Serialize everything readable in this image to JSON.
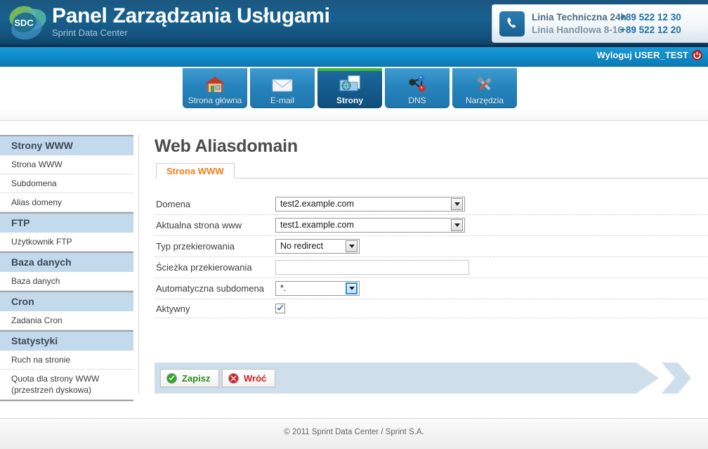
{
  "header": {
    "logo_text": "SDC",
    "title": "Panel Zarządzania Usługami",
    "subtitle": "Sprint Data Center",
    "phone": {
      "icon": "phone-icon",
      "line1_label": "Linia Techniczna 24h",
      "line1_number": "+89 522 12 30",
      "line2_label": "Linia Handlowa 8-16",
      "line2_number": "+89 522 12 20"
    }
  },
  "topbar": {
    "logout_label": "Wyloguj USER_TEST",
    "logout_icon": "power-icon"
  },
  "nav": {
    "tabs": [
      {
        "label": "Strona główna",
        "icon": "house-icon",
        "active": false
      },
      {
        "label": "E-mail",
        "icon": "envelope-icon",
        "active": false
      },
      {
        "label": "Strony",
        "icon": "web-folder-icon",
        "active": true
      },
      {
        "label": "DNS",
        "icon": "molecule-icon",
        "active": false
      },
      {
        "label": "Narzędzia",
        "icon": "tools-icon",
        "active": false
      }
    ]
  },
  "sidebar": {
    "groups": [
      {
        "title": "Strony WWW",
        "items": [
          "Strona WWW",
          "Subdomena",
          "Alias domeny"
        ]
      },
      {
        "title": "FTP",
        "items": [
          "Użytkownik FTP"
        ]
      },
      {
        "title": "Baza danych",
        "items": [
          "Baza danych"
        ]
      },
      {
        "title": "Cron",
        "items": [
          "Zadania Cron"
        ]
      },
      {
        "title": "Statystyki",
        "items": [
          "Ruch na stronie",
          "Quota dla strony WWW (przestrzeń dyskowa)"
        ]
      }
    ]
  },
  "main": {
    "page_title": "Web Aliasdomain",
    "strip_tab": "Strona WWW",
    "fields": {
      "domena": {
        "label": "Domena",
        "value": "test2.example.com"
      },
      "aktualna": {
        "label": "Aktualna strona www",
        "value": "test1.example.com"
      },
      "typ": {
        "label": "Typ przekierowania",
        "value": "No redirect"
      },
      "sciezka": {
        "label": "Ścieżka przekierowania",
        "value": "",
        "placeholder": ""
      },
      "subdomena": {
        "label": "Automatyczna subdomena",
        "value": "*."
      },
      "aktywny": {
        "label": "Aktywny",
        "checked": true
      }
    }
  },
  "actions": {
    "save_label": "Zapisz",
    "save_icon": "check-circle-icon",
    "back_label": "Wróć",
    "back_icon": "x-circle-icon"
  },
  "footer": {
    "text": "© 2011 Sprint Data Center / Sprint S.A."
  },
  "colors": {
    "header_blue": "#18608f",
    "bar_blue": "#0d8ccb",
    "accent_orange": "#f07d15",
    "active_tab_green": "#3db82e",
    "sidebar_head": "#c3d9ec",
    "action_band": "#cfdeeb"
  }
}
